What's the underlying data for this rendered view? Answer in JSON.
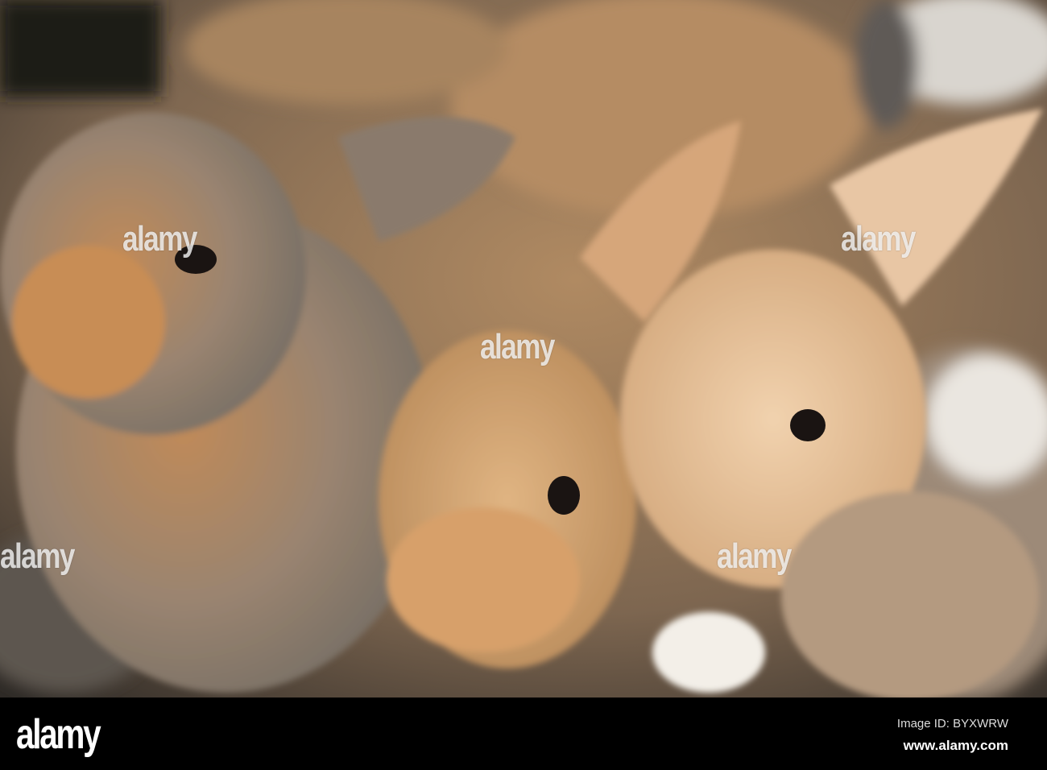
{
  "watermark": "alamy",
  "footer": {
    "logo": "alamy",
    "image_id": "Image ID: BYXWRW",
    "website": "www.alamy.com"
  }
}
